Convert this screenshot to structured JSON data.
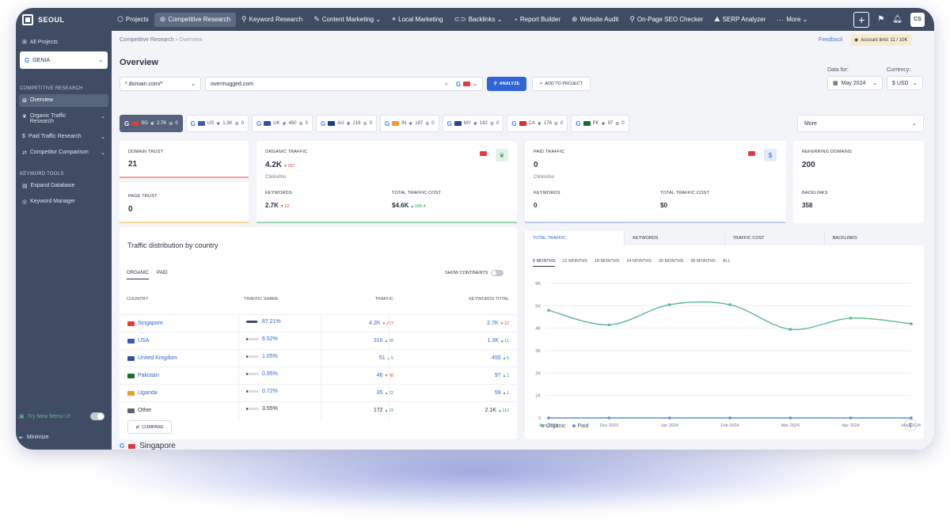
{
  "nav": {
    "brand": "SEOUL",
    "items": [
      {
        "icon": "⬡",
        "label": "Projects",
        "active": false
      },
      {
        "icon": "⊚",
        "label": "Competitive Research",
        "active": true
      },
      {
        "icon": "⚲",
        "label": "Keyword Research",
        "active": false
      },
      {
        "icon": "✎",
        "label": "Content Marketing ⌄",
        "active": false
      },
      {
        "icon": "⌖",
        "label": "Local Marketing",
        "active": false
      },
      {
        "icon": "⊂⊃",
        "label": "Backlinks ⌄",
        "active": false
      },
      {
        "icon": "◔",
        "label": "Report Builder",
        "active": false
      },
      {
        "icon": "⊕",
        "label": "Website Audit",
        "active": false
      },
      {
        "icon": "⚲",
        "label": "On-Page SEO Checker",
        "active": false
      },
      {
        "icon": "⛰",
        "label": "SERP Analyzer",
        "active": false
      },
      {
        "icon": "···",
        "label": "More ⌄",
        "active": false
      }
    ],
    "avatar": "CS"
  },
  "sidebar": {
    "all_projects": "All Projects",
    "project": "GENIA",
    "section1": "COMPETITIVE RESEARCH",
    "items": [
      "Overview",
      "Organic Traffic Research",
      "Paid Traffic Research",
      "Competitor Comparison"
    ],
    "section2": "KEYWORD TOOLS",
    "tools": [
      "Expand Database",
      "Keyword Manager"
    ],
    "try_new": "Try New Menu UI",
    "minimize": "Minimize"
  },
  "header": {
    "breadcrumb_root": "Competitive Research",
    "breadcrumb_current": "Overview",
    "feedback": "Feedback",
    "account_limit": "Account limit: 11 / 10K",
    "title": "Overview"
  },
  "search": {
    "domain_mode": "*.domain.com/*",
    "url": "overmugged.com",
    "analyze": "ANALYZE",
    "add_project": "ADD TO PROJECT",
    "data_for_label": "Data for:",
    "data_for": "May 2024",
    "currency_label": "Currency:",
    "currency": "$ USD"
  },
  "countries": [
    {
      "code": "SG",
      "traffic": "2.7K",
      "paid": "0",
      "flag": "#e03c3c",
      "active": true
    },
    {
      "code": "US",
      "traffic": "1.3K",
      "paid": "0",
      "flag": "#3b5bb5",
      "active": false
    },
    {
      "code": "UK",
      "traffic": "450",
      "paid": "0",
      "flag": "#2f4fa8",
      "active": false
    },
    {
      "code": "AU",
      "traffic": "216",
      "paid": "0",
      "flag": "#1f3c8f",
      "active": false
    },
    {
      "code": "IN",
      "traffic": "187",
      "paid": "0",
      "flag": "#f19a38",
      "active": false
    },
    {
      "code": "MY",
      "traffic": "192",
      "paid": "0",
      "flag": "#2c3f94",
      "active": false
    },
    {
      "code": "CA",
      "traffic": "176",
      "paid": "0",
      "flag": "#d8302b",
      "active": false
    },
    {
      "code": "PK",
      "traffic": "97",
      "paid": "0",
      "flag": "#1c6b34",
      "active": false
    }
  ],
  "more_label": "More",
  "metrics": {
    "domain_trust_label": "DOMAIN TRUST",
    "domain_trust": "21",
    "page_trust_label": "PAGE TRUST",
    "page_trust": "0",
    "organic_label": "ORGANIC TRAFFIC",
    "organic": "4.2K",
    "organic_delta": "▾ 267",
    "clicks_mo": "Clicks/mo",
    "keywords_label": "KEYWORDS",
    "keywords": "2.7K",
    "keywords_delta": "▾ 12",
    "ttc_label": "TOTAL TRAFFIC COST",
    "ttc": "$4.6K",
    "ttc_delta": "▴ 398.4",
    "paid_label": "PAID TRAFFIC",
    "paid": "0",
    "paid_clicks": "Clicks/mo",
    "paid_kw_label": "KEYWORDS",
    "paid_kw": "0",
    "paid_ttc_label": "TOTAL TRAFFIC COST",
    "paid_ttc": "$0",
    "ref_label": "REFERRING DOMAINS",
    "ref": "200",
    "bl_label": "BACKLINKS",
    "bl": "358"
  },
  "distribution": {
    "title": "Traffic distribution by country",
    "tab_organic": "ORGANIC",
    "tab_paid": "PAID",
    "show_continents": "SHOW CONTINENTS",
    "headers": [
      "COUNTRY",
      "TRAFFIC SHARE",
      "TRAFFIC",
      "KEYWORDS TOTAL"
    ],
    "rows": [
      {
        "country": "Singapore",
        "share": "87.21%",
        "share_frac": 0.87,
        "traffic": "4.2K",
        "t_delta": "▾ 267",
        "t_color": "#d9443c",
        "kw": "2.7K",
        "k_delta": "▾ 12",
        "k_color": "#d9443c",
        "flag": "#e03c3c"
      },
      {
        "country": "USA",
        "share": "6.52%",
        "share_frac": 0.07,
        "traffic": "316",
        "t_delta": "▴ 28",
        "t_color": "#2e9a63",
        "kw": "1.3K",
        "k_delta": "▴ 11",
        "k_color": "#2e9a63",
        "flag": "#3b5bb5"
      },
      {
        "country": "United Kingdom",
        "share": "1.05%",
        "share_frac": 0.01,
        "traffic": "51",
        "t_delta": "▴ 5",
        "t_color": "#2e9a63",
        "kw": "450",
        "k_delta": "▴ 5",
        "k_color": "#2e9a63",
        "flag": "#2f4fa8"
      },
      {
        "country": "Pakistan",
        "share": "0.95%",
        "share_frac": 0.01,
        "traffic": "46",
        "t_delta": "▾ 38",
        "t_color": "#d9443c",
        "kw": "97",
        "k_delta": "▴ 1",
        "k_color": "#2e9a63",
        "flag": "#1c6b34"
      },
      {
        "country": "Uganda",
        "share": "0.72%",
        "share_frac": 0.01,
        "traffic": "35",
        "t_delta": "▴ 22",
        "t_color": "#2e9a63",
        "kw": "59",
        "k_delta": "▴ 1",
        "k_color": "#2e9a63",
        "flag": "#e8a12b"
      },
      {
        "country": "Other",
        "share": "3.55%",
        "share_frac": 0.04,
        "traffic": "172",
        "t_delta": "▴ 23",
        "t_color": "#2e9a63",
        "kw": "2.1K",
        "k_delta": "▴ 110",
        "k_color": "#2e9a63",
        "flag": "#5b6275"
      }
    ],
    "compare": "COMPARE"
  },
  "chart_panel": {
    "tabs": [
      "TOTAL TRAFFIC",
      "KEYWORDS",
      "TRAFFIC COST",
      "BACKLINKS"
    ],
    "periods": [
      "6 MONTHS",
      "12 MONTHS",
      "18 MONTHS",
      "24 MONTHS",
      "30 MONTHS",
      "36 MONTHS",
      "ALL"
    ],
    "legend_organic": "Organic",
    "legend_paid": "Paid"
  },
  "chart_data": {
    "type": "line",
    "x": [
      "Nov 2023",
      "Dec 2023",
      "Jan 2024",
      "Feb 2024",
      "Mar 2024",
      "Apr 2024",
      "May 2024"
    ],
    "series": [
      {
        "name": "Organic",
        "values": [
          4800,
          4150,
          5050,
          5050,
          3950,
          4450,
          4200
        ],
        "color": "#5db88a"
      },
      {
        "name": "Paid",
        "values": [
          0,
          0,
          0,
          0,
          0,
          0,
          0
        ],
        "color": "#5b8fd6"
      }
    ],
    "yticks": [
      "0",
      "1K",
      "2K",
      "3K",
      "4K",
      "5K",
      "6K"
    ],
    "ylim": [
      0,
      6000
    ]
  },
  "section_bottom": "Singapore"
}
